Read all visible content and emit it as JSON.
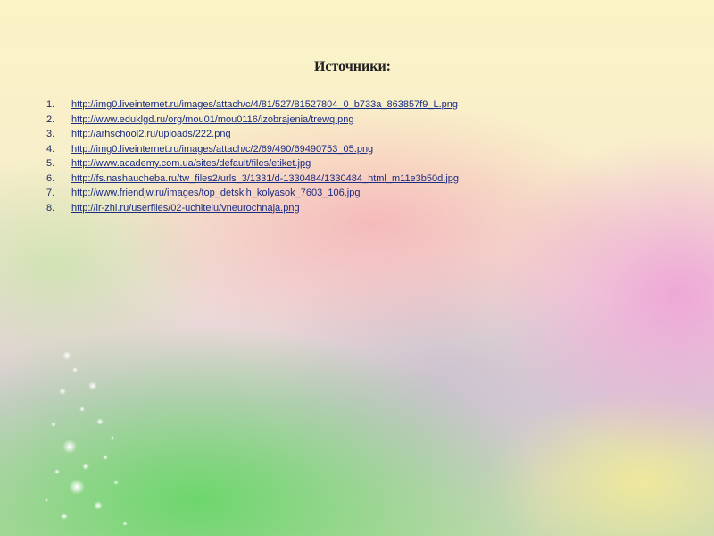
{
  "slide": {
    "title": "Источники:",
    "sources": [
      {
        "num": "1.",
        "url": "http://img0.liveinternet.ru/images/attach/c/4/81/527/81527804_0_b733a_863857f9_L.png"
      },
      {
        "num": "2.",
        "url": "http://www.eduklgd.ru/org/mou01/mou0116/izobrajenia/trewq.png"
      },
      {
        "num": "3.",
        "url": "http://arhschool2.ru/uploads/222.png"
      },
      {
        "num": "4.",
        "url": "http://img0.liveinternet.ru/images/attach/c/2/69/490/69490753_05.png"
      },
      {
        "num": "5.",
        "url": "http://www.academy.com.ua/sites/default/files/etiket.jpg"
      },
      {
        "num": "6.",
        "url": "http://fs.nashaucheba.ru/tw_files2/urls_3/1331/d-1330484/1330484_html_m11e3b50d.jpg"
      },
      {
        "num": "7.",
        "url": "http://www.friendjw.ru/images/top_detskih_kolyasok_7603_106.jpg"
      },
      {
        "num": "8.",
        "url": "http://ir-zhi.ru/userfiles/02-uchitelu/vneurochnaja.png"
      }
    ]
  },
  "colors": {
    "link": "#1a2c84",
    "title": "#222222",
    "green_glow": "#68d668",
    "pink_glow": "#ee96d7",
    "yellow_top": "#fbf3c6"
  }
}
